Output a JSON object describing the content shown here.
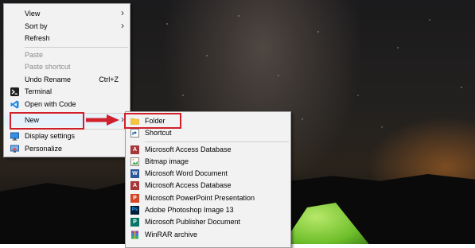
{
  "context_menu": {
    "items": [
      {
        "label": "View",
        "has_submenu": true
      },
      {
        "label": "Sort by",
        "has_submenu": true
      },
      {
        "label": "Refresh"
      },
      {
        "label": "Paste",
        "disabled": true
      },
      {
        "label": "Paste shortcut",
        "disabled": true
      },
      {
        "label": "Undo Rename",
        "shortcut": "Ctrl+Z"
      },
      {
        "label": "Terminal",
        "icon": "terminal-icon"
      },
      {
        "label": "Open with Code",
        "icon": "vscode-icon"
      },
      {
        "label": "New",
        "has_submenu": true
      },
      {
        "label": "Display settings",
        "icon": "display-settings-icon"
      },
      {
        "label": "Personalize",
        "icon": "personalize-icon"
      }
    ]
  },
  "new_submenu": {
    "items": [
      {
        "label": "Folder",
        "icon": "folder-icon"
      },
      {
        "label": "Shortcut",
        "icon": "shortcut-icon"
      },
      {
        "label": "Microsoft Access Database",
        "icon": "access-icon"
      },
      {
        "label": "Bitmap image",
        "icon": "bitmap-icon"
      },
      {
        "label": "Microsoft Word Document",
        "icon": "word-icon"
      },
      {
        "label": "Microsoft Access Database",
        "icon": "access-icon"
      },
      {
        "label": "Microsoft PowerPoint Presentation",
        "icon": "powerpoint-icon"
      },
      {
        "label": "Adobe Photoshop Image 13",
        "icon": "photoshop-icon"
      },
      {
        "label": "Microsoft Publisher Document",
        "icon": "publisher-icon"
      },
      {
        "label": "WinRAR archive",
        "icon": "winrar-icon"
      }
    ]
  },
  "colors": {
    "highlight": "#d0212b",
    "menu_bg": "#f2f2f2",
    "folder": "#f5c542",
    "word": "#2b579a",
    "access": "#a4373a",
    "powerpoint": "#d24726",
    "photoshop": "#001e36",
    "publisher": "#077568"
  }
}
